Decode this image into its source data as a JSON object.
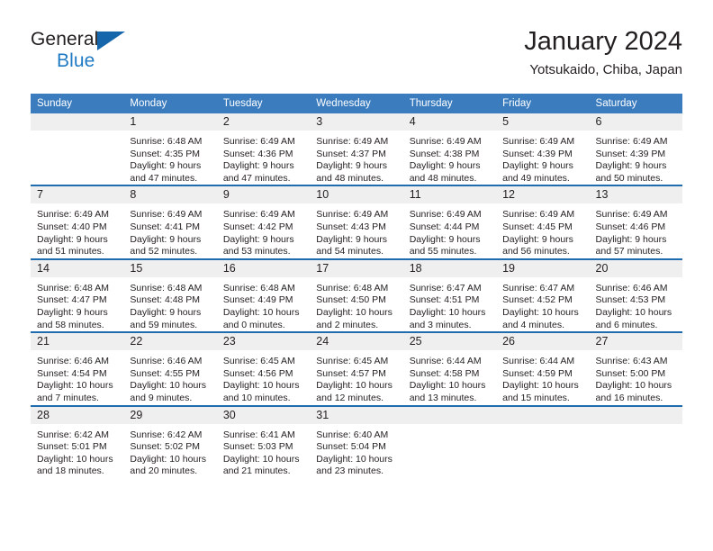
{
  "brand": {
    "line1": "General",
    "line2": "Blue",
    "flag_color": "#1566ab",
    "text_color": "#231f20",
    "accent_color": "#1f7ac4"
  },
  "header": {
    "title": "January 2024",
    "subtitle": "Yotsukaido, Chiba, Japan"
  },
  "theme": {
    "header_bg": "#3a7cbe",
    "row_divider": "#1f6cae",
    "daynum_bg": "#efefef",
    "text": "#231f20"
  },
  "weekday_headers": [
    "Sunday",
    "Monday",
    "Tuesday",
    "Wednesday",
    "Thursday",
    "Friday",
    "Saturday"
  ],
  "weeks": [
    [
      {
        "day": "",
        "sunrise": "",
        "sunset": "",
        "daylight_1": "",
        "daylight_2": ""
      },
      {
        "day": "1",
        "sunrise": "Sunrise: 6:48 AM",
        "sunset": "Sunset: 4:35 PM",
        "daylight_1": "Daylight: 9 hours",
        "daylight_2": "and 47 minutes."
      },
      {
        "day": "2",
        "sunrise": "Sunrise: 6:49 AM",
        "sunset": "Sunset: 4:36 PM",
        "daylight_1": "Daylight: 9 hours",
        "daylight_2": "and 47 minutes."
      },
      {
        "day": "3",
        "sunrise": "Sunrise: 6:49 AM",
        "sunset": "Sunset: 4:37 PM",
        "daylight_1": "Daylight: 9 hours",
        "daylight_2": "and 48 minutes."
      },
      {
        "day": "4",
        "sunrise": "Sunrise: 6:49 AM",
        "sunset": "Sunset: 4:38 PM",
        "daylight_1": "Daylight: 9 hours",
        "daylight_2": "and 48 minutes."
      },
      {
        "day": "5",
        "sunrise": "Sunrise: 6:49 AM",
        "sunset": "Sunset: 4:39 PM",
        "daylight_1": "Daylight: 9 hours",
        "daylight_2": "and 49 minutes."
      },
      {
        "day": "6",
        "sunrise": "Sunrise: 6:49 AM",
        "sunset": "Sunset: 4:39 PM",
        "daylight_1": "Daylight: 9 hours",
        "daylight_2": "and 50 minutes."
      }
    ],
    [
      {
        "day": "7",
        "sunrise": "Sunrise: 6:49 AM",
        "sunset": "Sunset: 4:40 PM",
        "daylight_1": "Daylight: 9 hours",
        "daylight_2": "and 51 minutes."
      },
      {
        "day": "8",
        "sunrise": "Sunrise: 6:49 AM",
        "sunset": "Sunset: 4:41 PM",
        "daylight_1": "Daylight: 9 hours",
        "daylight_2": "and 52 minutes."
      },
      {
        "day": "9",
        "sunrise": "Sunrise: 6:49 AM",
        "sunset": "Sunset: 4:42 PM",
        "daylight_1": "Daylight: 9 hours",
        "daylight_2": "and 53 minutes."
      },
      {
        "day": "10",
        "sunrise": "Sunrise: 6:49 AM",
        "sunset": "Sunset: 4:43 PM",
        "daylight_1": "Daylight: 9 hours",
        "daylight_2": "and 54 minutes."
      },
      {
        "day": "11",
        "sunrise": "Sunrise: 6:49 AM",
        "sunset": "Sunset: 4:44 PM",
        "daylight_1": "Daylight: 9 hours",
        "daylight_2": "and 55 minutes."
      },
      {
        "day": "12",
        "sunrise": "Sunrise: 6:49 AM",
        "sunset": "Sunset: 4:45 PM",
        "daylight_1": "Daylight: 9 hours",
        "daylight_2": "and 56 minutes."
      },
      {
        "day": "13",
        "sunrise": "Sunrise: 6:49 AM",
        "sunset": "Sunset: 4:46 PM",
        "daylight_1": "Daylight: 9 hours",
        "daylight_2": "and 57 minutes."
      }
    ],
    [
      {
        "day": "14",
        "sunrise": "Sunrise: 6:48 AM",
        "sunset": "Sunset: 4:47 PM",
        "daylight_1": "Daylight: 9 hours",
        "daylight_2": "and 58 minutes."
      },
      {
        "day": "15",
        "sunrise": "Sunrise: 6:48 AM",
        "sunset": "Sunset: 4:48 PM",
        "daylight_1": "Daylight: 9 hours",
        "daylight_2": "and 59 minutes."
      },
      {
        "day": "16",
        "sunrise": "Sunrise: 6:48 AM",
        "sunset": "Sunset: 4:49 PM",
        "daylight_1": "Daylight: 10 hours",
        "daylight_2": "and 0 minutes."
      },
      {
        "day": "17",
        "sunrise": "Sunrise: 6:48 AM",
        "sunset": "Sunset: 4:50 PM",
        "daylight_1": "Daylight: 10 hours",
        "daylight_2": "and 2 minutes."
      },
      {
        "day": "18",
        "sunrise": "Sunrise: 6:47 AM",
        "sunset": "Sunset: 4:51 PM",
        "daylight_1": "Daylight: 10 hours",
        "daylight_2": "and 3 minutes."
      },
      {
        "day": "19",
        "sunrise": "Sunrise: 6:47 AM",
        "sunset": "Sunset: 4:52 PM",
        "daylight_1": "Daylight: 10 hours",
        "daylight_2": "and 4 minutes."
      },
      {
        "day": "20",
        "sunrise": "Sunrise: 6:46 AM",
        "sunset": "Sunset: 4:53 PM",
        "daylight_1": "Daylight: 10 hours",
        "daylight_2": "and 6 minutes."
      }
    ],
    [
      {
        "day": "21",
        "sunrise": "Sunrise: 6:46 AM",
        "sunset": "Sunset: 4:54 PM",
        "daylight_1": "Daylight: 10 hours",
        "daylight_2": "and 7 minutes."
      },
      {
        "day": "22",
        "sunrise": "Sunrise: 6:46 AM",
        "sunset": "Sunset: 4:55 PM",
        "daylight_1": "Daylight: 10 hours",
        "daylight_2": "and 9 minutes."
      },
      {
        "day": "23",
        "sunrise": "Sunrise: 6:45 AM",
        "sunset": "Sunset: 4:56 PM",
        "daylight_1": "Daylight: 10 hours",
        "daylight_2": "and 10 minutes."
      },
      {
        "day": "24",
        "sunrise": "Sunrise: 6:45 AM",
        "sunset": "Sunset: 4:57 PM",
        "daylight_1": "Daylight: 10 hours",
        "daylight_2": "and 12 minutes."
      },
      {
        "day": "25",
        "sunrise": "Sunrise: 6:44 AM",
        "sunset": "Sunset: 4:58 PM",
        "daylight_1": "Daylight: 10 hours",
        "daylight_2": "and 13 minutes."
      },
      {
        "day": "26",
        "sunrise": "Sunrise: 6:44 AM",
        "sunset": "Sunset: 4:59 PM",
        "daylight_1": "Daylight: 10 hours",
        "daylight_2": "and 15 minutes."
      },
      {
        "day": "27",
        "sunrise": "Sunrise: 6:43 AM",
        "sunset": "Sunset: 5:00 PM",
        "daylight_1": "Daylight: 10 hours",
        "daylight_2": "and 16 minutes."
      }
    ],
    [
      {
        "day": "28",
        "sunrise": "Sunrise: 6:42 AM",
        "sunset": "Sunset: 5:01 PM",
        "daylight_1": "Daylight: 10 hours",
        "daylight_2": "and 18 minutes."
      },
      {
        "day": "29",
        "sunrise": "Sunrise: 6:42 AM",
        "sunset": "Sunset: 5:02 PM",
        "daylight_1": "Daylight: 10 hours",
        "daylight_2": "and 20 minutes."
      },
      {
        "day": "30",
        "sunrise": "Sunrise: 6:41 AM",
        "sunset": "Sunset: 5:03 PM",
        "daylight_1": "Daylight: 10 hours",
        "daylight_2": "and 21 minutes."
      },
      {
        "day": "31",
        "sunrise": "Sunrise: 6:40 AM",
        "sunset": "Sunset: 5:04 PM",
        "daylight_1": "Daylight: 10 hours",
        "daylight_2": "and 23 minutes."
      },
      {
        "day": "",
        "sunrise": "",
        "sunset": "",
        "daylight_1": "",
        "daylight_2": ""
      },
      {
        "day": "",
        "sunrise": "",
        "sunset": "",
        "daylight_1": "",
        "daylight_2": ""
      },
      {
        "day": "",
        "sunrise": "",
        "sunset": "",
        "daylight_1": "",
        "daylight_2": ""
      }
    ]
  ]
}
